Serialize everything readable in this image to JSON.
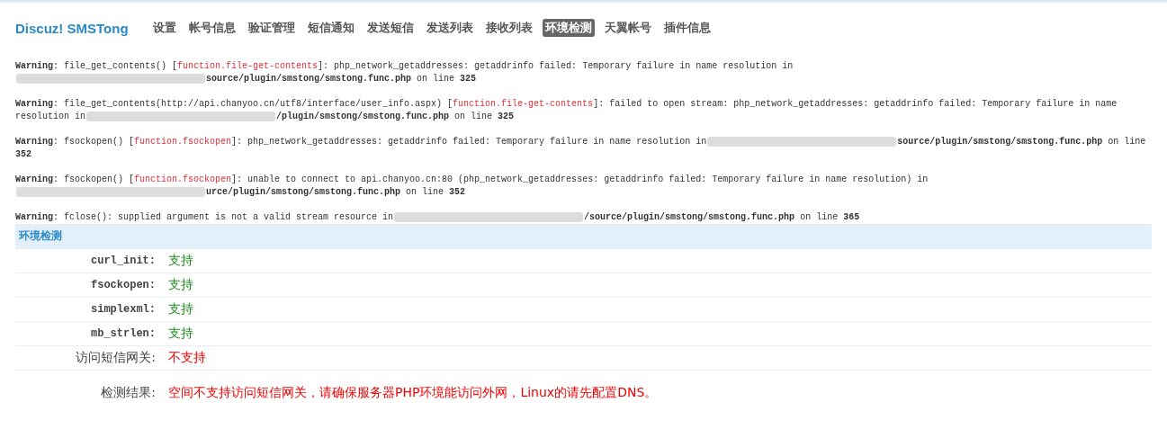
{
  "header": {
    "logo": "Discuz! SMSTong",
    "tabs": [
      {
        "label": "设置",
        "selected": false
      },
      {
        "label": "帐号信息",
        "selected": false
      },
      {
        "label": "验证管理",
        "selected": false
      },
      {
        "label": "短信通知",
        "selected": false
      },
      {
        "label": "发送短信",
        "selected": false
      },
      {
        "label": "发送列表",
        "selected": false
      },
      {
        "label": "接收列表",
        "selected": false
      },
      {
        "label": "环境检测",
        "selected": true
      },
      {
        "label": "天翼帐号",
        "selected": false
      },
      {
        "label": "插件信息",
        "selected": false
      }
    ]
  },
  "warnings": [
    [
      {
        "kind": "text",
        "text": "**Warning**: file_get_contents() ["
      },
      {
        "kind": "link",
        "text": "function.file-get-contents"
      },
      {
        "kind": "text",
        "text": "]: php_network_getaddresses: getaddrinfo failed: Temporary failure in name resolution in"
      },
      {
        "kind": "break"
      },
      {
        "kind": "redacted"
      },
      {
        "kind": "text",
        "text": "**source/plugin/smstong/smstong.func.php** on line **325**"
      }
    ],
    [
      {
        "kind": "text",
        "text": "**Warning**: file_get_contents(http://api.chanyoo.cn/utf8/interface/user_info.aspx) ["
      },
      {
        "kind": "link",
        "text": "function.file-get-contents"
      },
      {
        "kind": "text",
        "text": "]: failed to open stream: php_network_getaddresses: getaddrinfo failed: Temporary failure in name"
      },
      {
        "kind": "break"
      },
      {
        "kind": "text",
        "text": "resolution in"
      },
      {
        "kind": "redacted"
      },
      {
        "kind": "text",
        "text": "**/plugin/smstong/smstong.func.php** on line **325**"
      }
    ],
    [
      {
        "kind": "text",
        "text": "**Warning**: fsockopen() ["
      },
      {
        "kind": "link",
        "text": "function.fsockopen"
      },
      {
        "kind": "text",
        "text": "]: php_network_getaddresses: getaddrinfo failed: Temporary failure in name resolution in"
      },
      {
        "kind": "redacted"
      },
      {
        "kind": "text",
        "text": "**source/plugin/smstong/smstong.func.php** on line"
      },
      {
        "kind": "break"
      },
      {
        "kind": "text",
        "text": "**352**"
      }
    ],
    [
      {
        "kind": "text",
        "text": "**Warning**: fsockopen() ["
      },
      {
        "kind": "link",
        "text": "function.fsockopen"
      },
      {
        "kind": "text",
        "text": "]: unable to connect to api.chanyoo.cn:80 (php_network_getaddresses: getaddrinfo failed: Temporary failure in name resolution) in"
      },
      {
        "kind": "break"
      },
      {
        "kind": "redacted"
      },
      {
        "kind": "text",
        "text": "**urce/plugin/smstong/smstong.func.php** on line **352**"
      }
    ],
    [
      {
        "kind": "text",
        "text": "**Warning**: fclose(): supplied argument is not a valid stream resource in"
      },
      {
        "kind": "redacted"
      },
      {
        "kind": "text",
        "text": "**/source/plugin/smstong/smstong.func.php** on line **365**"
      }
    ]
  ],
  "panel": {
    "title": "环境检测",
    "checks": [
      {
        "label": "curl_init:",
        "value": "支持",
        "supported": true
      },
      {
        "label": "fsockopen:",
        "value": "支持",
        "supported": true
      },
      {
        "label": "simplexml:",
        "value": "支持",
        "supported": true
      },
      {
        "label": "mb_strlen:",
        "value": "支持",
        "supported": true
      },
      {
        "label": "访问短信网关:",
        "value": "不支持",
        "supported": false
      }
    ],
    "result": {
      "label": "检测结果:",
      "message": "空间不支持访问短信网关，请确保服务器PHP环境能访问外网，Linux的请先配置DNS。"
    }
  }
}
